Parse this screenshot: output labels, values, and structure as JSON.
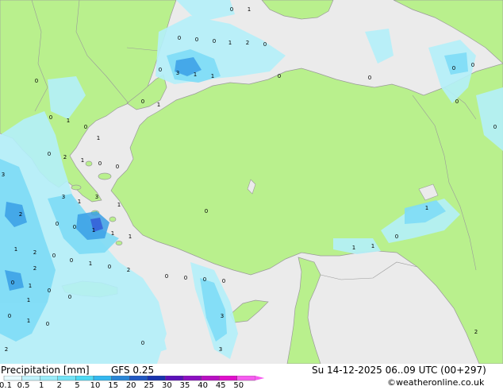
{
  "footer": {
    "title": "Precipitation [mm]",
    "model": "GFS 0.25",
    "valid": "Su 14-12-2025 06..09 UTC (00+297)",
    "credit": "©weatheronline.co.uk"
  },
  "legend": {
    "ticks": [
      "0.1",
      "0.5",
      "1",
      "2",
      "5",
      "10",
      "15",
      "20",
      "25",
      "30",
      "35",
      "40",
      "45",
      "50"
    ],
    "colors": [
      "#e6fafd",
      "#bff2fb",
      "#99ebf8",
      "#73e3f6",
      "#4ed9f3",
      "#33b8ef",
      "#2a86d6",
      "#2158c2",
      "#1833ad",
      "#5b11b9",
      "#8c0fc2",
      "#b80fc2",
      "#e00fcb",
      "#f75cf0"
    ]
  },
  "colors": {
    "land": "#b9f08d",
    "sea": "#ebebeb",
    "border": "#9a9a9a",
    "precip_light": "#b4f0fa",
    "precip_mid": "#7edcf6",
    "precip_heavy": "#3a9fe6",
    "precip_max": "#3560d8"
  },
  "map_values": [
    "0",
    "1",
    "0",
    "0",
    "0",
    "1",
    "2",
    "0",
    "0",
    "0",
    "3",
    "1",
    "1",
    "0",
    "0",
    "0",
    "0",
    "0",
    "0",
    "0",
    "1",
    "0",
    "0",
    "1",
    "0",
    "2",
    "1",
    "0",
    "0",
    "3",
    "0",
    "1",
    "2",
    "0",
    "0",
    "1",
    "1",
    "1",
    "3",
    "1",
    "2",
    "0",
    "0",
    "1",
    "0",
    "2",
    "1",
    "1",
    "0",
    "0",
    "0",
    "0",
    "0",
    "1",
    "0",
    "0",
    "0",
    "1",
    "0",
    "0",
    "3",
    "3",
    "2",
    "1",
    "3",
    "1",
    "1",
    "2",
    "1",
    "0",
    "2"
  ]
}
